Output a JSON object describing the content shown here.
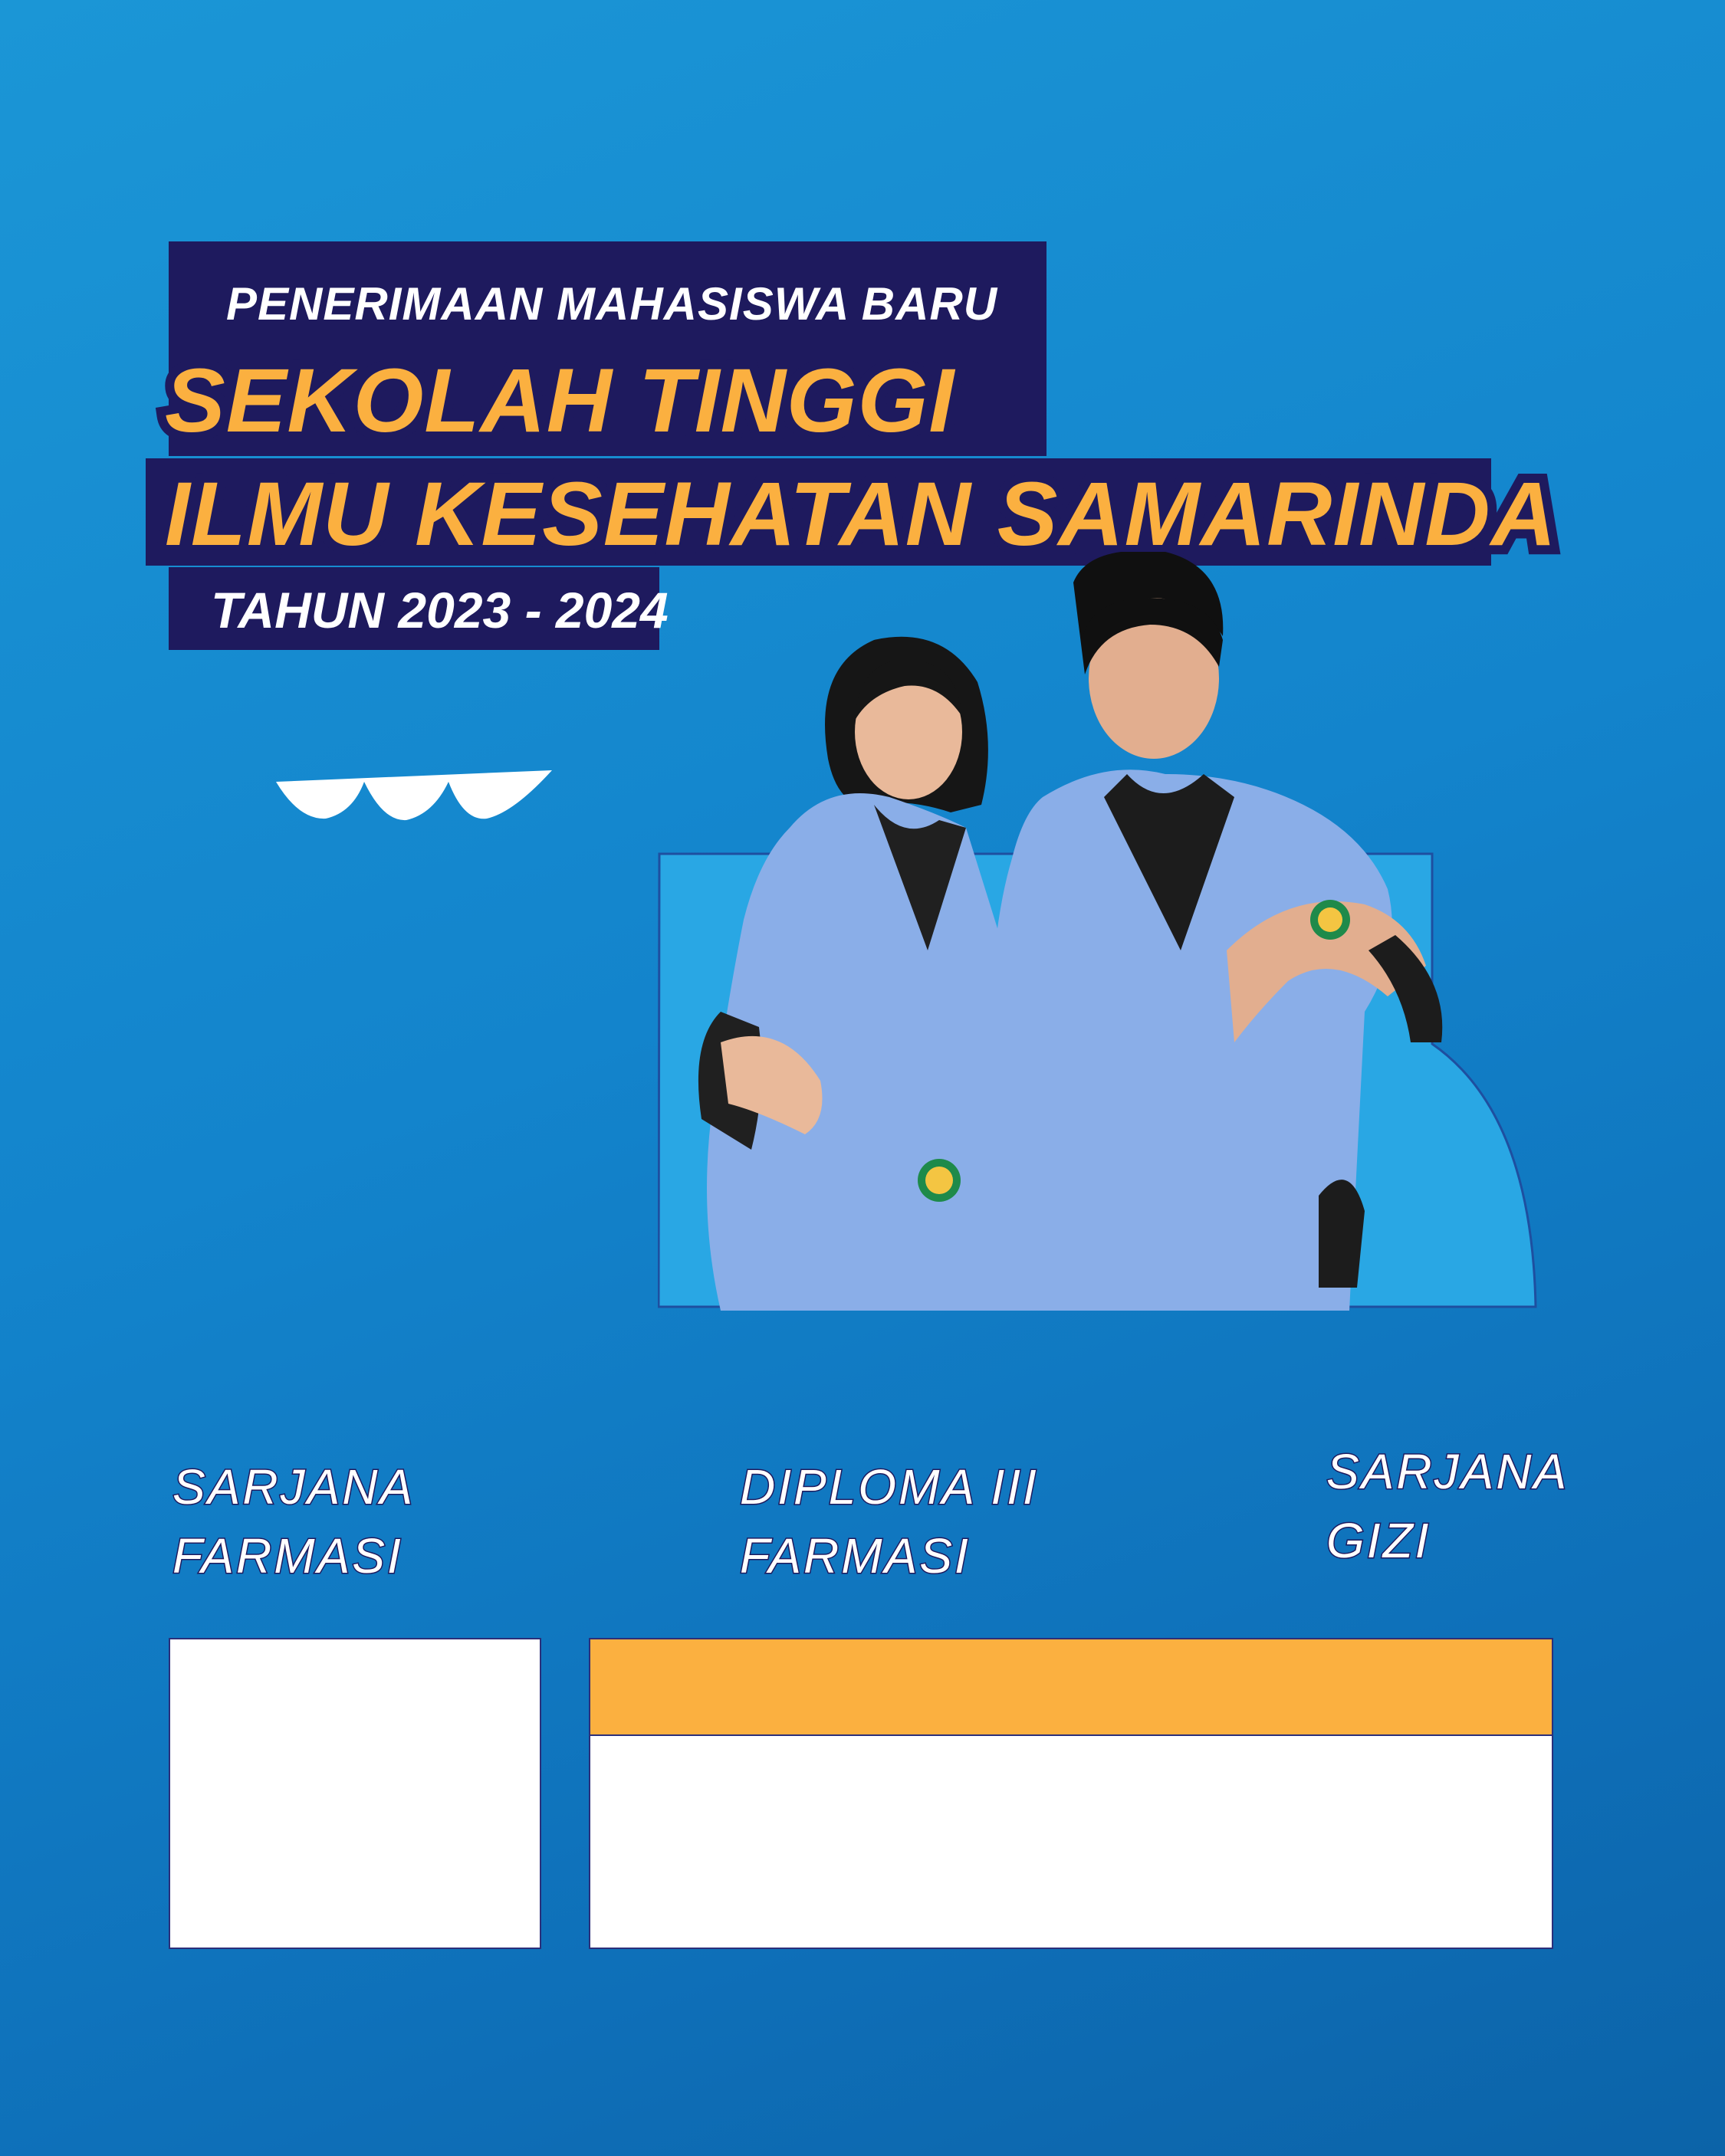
{
  "header": {
    "kicker": "PENERIMAAN MAHASISWA BARU",
    "title_line1": "SEKOLAH TINGGI",
    "title_line2": "ILMU KESEHATAN SAMARINDA",
    "year": "TAHUN 2023 - 2024"
  },
  "programs": [
    {
      "line1": "SARJANA",
      "line2": "FARMASI"
    },
    {
      "line1": "DIPLOMA III",
      "line2": "FARMASI"
    },
    {
      "line1": "SARJANA",
      "line2": "GIZI"
    }
  ],
  "colors": {
    "background": "#1384cc",
    "navy": "#1e1a5e",
    "accent_orange": "#fbb040",
    "light_blue_panel": "#29a7e4",
    "jacket_blue": "#8aaee8"
  },
  "photo": {
    "subject": "two students in light-blue lab coats pointing at themselves"
  }
}
